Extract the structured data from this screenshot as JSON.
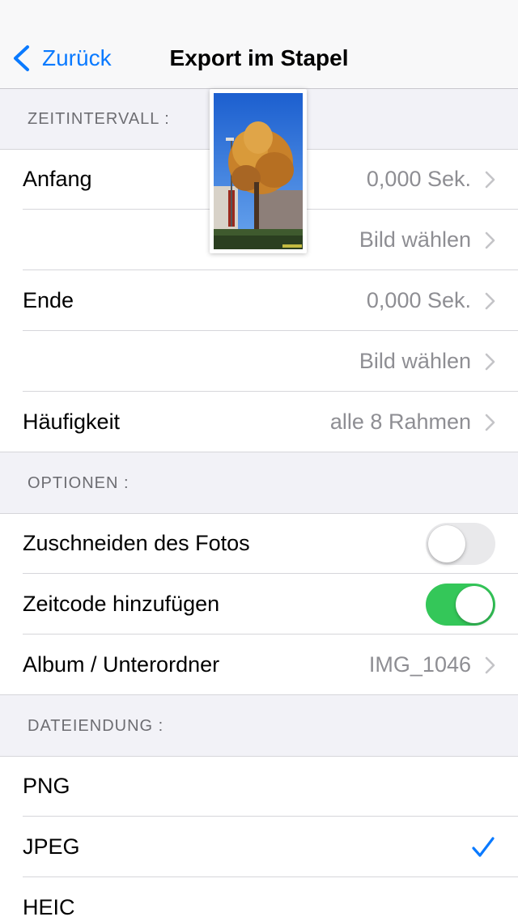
{
  "nav": {
    "back_label": "Zurück",
    "title": "Export im Stapel"
  },
  "sections": {
    "interval_header": "ZEITINTERVALL :",
    "options_header": "OPTIONEN :",
    "extension_header": "DATEIENDUNG :"
  },
  "interval": {
    "start_label": "Anfang",
    "start_value": "0,000 Sek.",
    "start_pick": "Bild wählen",
    "end_label": "Ende",
    "end_value": "0,000 Sek.",
    "end_pick": "Bild wählen",
    "frequency_label": "Häufigkeit",
    "frequency_value": "alle 8 Rahmen"
  },
  "options": {
    "crop_label": "Zuschneiden des Fotos",
    "crop_enabled": false,
    "timecode_label": "Zeitcode hinzufügen",
    "timecode_enabled": true,
    "album_label": "Album / Unterordner",
    "album_value": "IMG_1046"
  },
  "extensions": {
    "items": [
      "PNG",
      "JPEG",
      "HEIC"
    ],
    "selected": "JPEG"
  },
  "colors": {
    "accent": "#0a7aff",
    "toggle_on": "#34c759",
    "secondary_text": "#8e8e93"
  }
}
